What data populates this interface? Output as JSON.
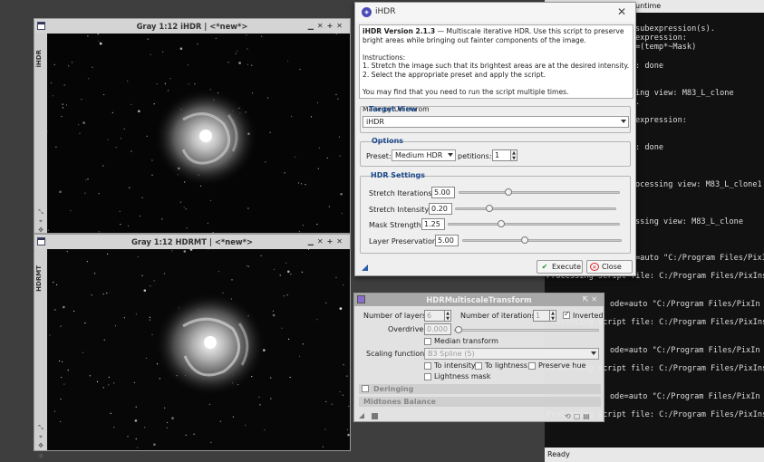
{
  "console": {
    "title": "untime",
    "lines": [
      "subexpression(s).",
      "expression:",
      "=(temp*~Mask)",
      ": done",
      "ing view: M83_L_clone",
      ".",
      "expression:",
      ": done",
      "ocessing view: M83_L_clone1",
      "ssing view: M83_L_clone",
      "=auto \"C:/Program Files/PixIn",
      "Processing script file: C:/Program Files/PixIns",
      "ode=auto \"C:/Program Files/PixIn",
      "Processing script file: C:/Program Files/PixIns",
      "ode=auto \"C:/Program Files/PixIn",
      "Processing script file: C:/Program Files/PixIns",
      "ode=auto \"C:/Program Files/PixIn",
      "Processing script file: C:/Program Files/PixIns"
    ],
    "status": "Ready"
  },
  "win1": {
    "title": "Gray 1:12 iHDR | <*new*>",
    "side_label": "iHDR"
  },
  "win2": {
    "title": "Gray 1:12 HDRMT | <*new*>",
    "side_label": "HDRMT"
  },
  "ihdr": {
    "title": "iHDR",
    "info_head": "iHDR Version 2.1.3",
    "info_text": " — Multiscale iterative HDR. Use this script to preserve bright areas while bringing out fainter components of the image.",
    "instructions": "Instructions:",
    "step1": "1. Stretch the image such that its brightest areas are at the desired intensity.",
    "step2": "2. Select the appropriate preset and apply the script.",
    "note": "You may find that you need to run the script multiple times.",
    "author": "Made by Uri Darom",
    "target_view_title": "Target View",
    "target_view_value": "iHDR",
    "options_title": "Options",
    "preset_label": "Preset:",
    "preset_value": "Medium HDR",
    "repetitions_label": "petitions:",
    "repetitions_value": "1",
    "settings_title": "HDR Settings",
    "stretch_iter_label": "Stretch Iterations:",
    "stretch_iter_value": "5.00",
    "stretch_intensity_label": "Stretch Intensity:",
    "stretch_intensity_value": "0.20",
    "mask_strength_label": "Mask Strength:",
    "mask_strength_value": "1.25",
    "layer_pres_label": "Layer Preservation:",
    "layer_pres_value": "5.00",
    "execute_label": "Execute",
    "close_label": "Close"
  },
  "hdrmt": {
    "title": "HDRMultiscaleTransform",
    "layers_label": "Number of layers:",
    "layers_value": "6",
    "iterations_label": "Number of iterations:",
    "iterations_value": "1",
    "inverted_label": "Inverted",
    "overdrive_label": "Overdrive:",
    "overdrive_value": "0.000",
    "median_label": "Median transform",
    "scaling_label": "Scaling function:",
    "scaling_value": "B3 Spline (5)",
    "to_intensity_label": "To intensity",
    "to_lightness_label": "To lightness",
    "preserve_hue_label": "Preserve hue",
    "lightness_mask_label": "Lightness mask",
    "deringing_label": "Deringing",
    "midtones_label": "Midtones Balance"
  }
}
